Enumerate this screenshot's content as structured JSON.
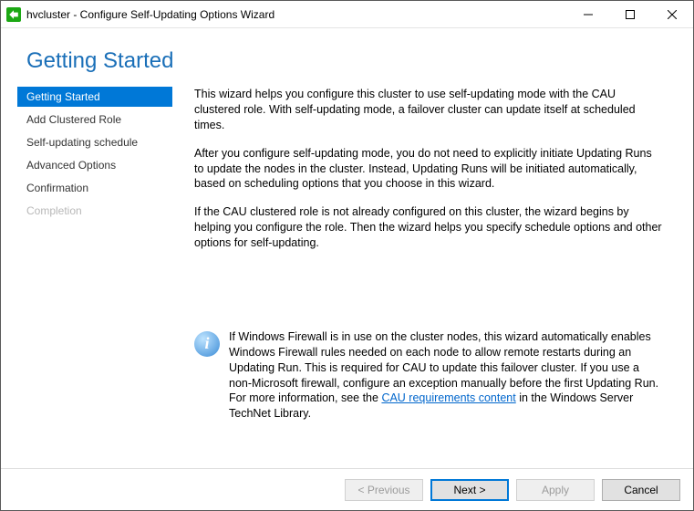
{
  "window": {
    "title": "hvcluster - Configure Self-Updating Options Wizard"
  },
  "header": {
    "title": "Getting Started"
  },
  "sidebar": {
    "steps": [
      {
        "label": "Getting Started",
        "state": "active"
      },
      {
        "label": "Add Clustered Role",
        "state": "normal"
      },
      {
        "label": "Self-updating schedule",
        "state": "normal"
      },
      {
        "label": "Advanced Options",
        "state": "normal"
      },
      {
        "label": "Confirmation",
        "state": "normal"
      },
      {
        "label": "Completion",
        "state": "disabled"
      }
    ]
  },
  "content": {
    "p1": "This wizard helps you configure this cluster to use self-updating mode with the CAU clustered role. With self-updating mode, a failover cluster can update itself at scheduled times.",
    "p2": "After you configure self-updating mode, you do not need to explicitly initiate Updating Runs to update the nodes in the cluster. Instead, Updating Runs will be initiated automatically, based on scheduling options that you choose in this wizard.",
    "p3": "If the CAU clustered role is not already configured on this cluster, the wizard begins by helping you configure the role. Then the wizard helps you specify schedule options and other options for self-updating.",
    "info_pre": "If Windows Firewall is in use on the cluster nodes, this wizard automatically enables Windows Firewall rules needed on each node to allow remote restarts during an Updating Run. This is required for CAU to update this failover cluster. If you use a non-Microsoft firewall, configure an exception manually before the first Updating Run. For more information, see the ",
    "info_link": "CAU requirements content",
    "info_post": " in the Windows Server TechNet Library."
  },
  "footer": {
    "previous": "< Previous",
    "next": "Next >",
    "apply": "Apply",
    "cancel": "Cancel"
  }
}
